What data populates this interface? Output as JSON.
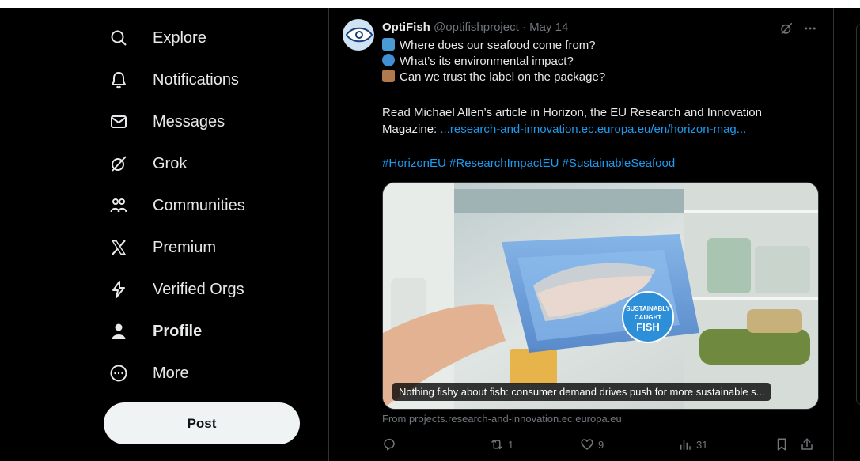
{
  "nav": {
    "items": [
      {
        "label": "Explore",
        "icon": "search-icon"
      },
      {
        "label": "Notifications",
        "icon": "bell-icon"
      },
      {
        "label": "Messages",
        "icon": "envelope-icon"
      },
      {
        "label": "Grok",
        "icon": "grok-icon"
      },
      {
        "label": "Communities",
        "icon": "people-icon"
      },
      {
        "label": "Premium",
        "icon": "x-logo-icon"
      },
      {
        "label": "Verified Orgs",
        "icon": "lightning-icon"
      },
      {
        "label": "Profile",
        "icon": "person-icon"
      },
      {
        "label": "More",
        "icon": "more-circle-icon"
      }
    ],
    "post_label": "Post"
  },
  "tweet": {
    "author_name": "OptiFish",
    "handle": "@optifishproject",
    "separator": "·",
    "date": "May 14",
    "lines": [
      "Where does our seafood come from?",
      "What’s its environmental impact?",
      "Can we trust the label on the package?"
    ],
    "line_icons": [
      "fish-emoji",
      "globe-emoji",
      "package-emoji"
    ],
    "article_text_1": "Read Michael Allen’s article in Horizon, the EU Research and Innovation",
    "article_text_2": "Magazine: ",
    "article_link": "...research-and-innovation.ec.europa.eu/en/horizon-mag...",
    "hashtags": "#HorizonEU #ResearchImpactEU #SustainableSeafood",
    "media_caption": "Nothing fishy about fish: consumer demand drives push for more sustainable s...",
    "sticker_text_1": "SUSTAINABLY",
    "sticker_text_2": "CAUGHT",
    "sticker_text_3": "FISH",
    "source": "From projects.research-and-innovation.ec.europa.eu",
    "replies": "",
    "reposts": "1",
    "likes": "9",
    "views": "31"
  },
  "colors": {
    "accent": "#1d9bf0",
    "muted": "#71767b",
    "text": "#e7e9ea",
    "background": "#000000"
  }
}
